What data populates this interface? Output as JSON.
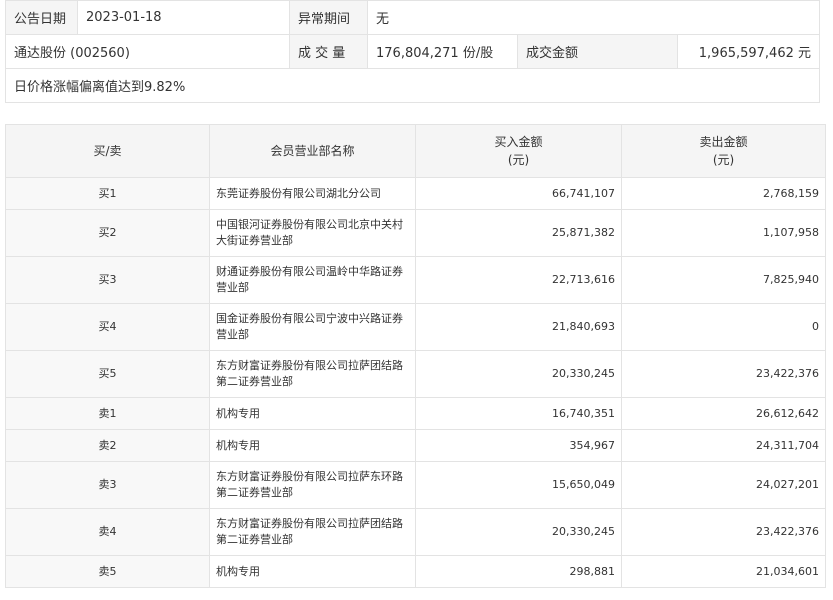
{
  "summary": {
    "announce_date_label": "公告日期",
    "announce_date_value": "2023-01-18",
    "abnormal_period_label": "异常期间",
    "abnormal_period_value": "无",
    "stock_name": "通达股份 (002560)",
    "volume_label": "成 交 量",
    "volume_value": "176,804,271 份/股",
    "amount_label": "成交金额",
    "amount_value": "1,965,597,462 元",
    "reason": "日价格涨幅偏离值达到9.82%"
  },
  "detail": {
    "headers": {
      "side": "买/卖",
      "dept": "会员营业部名称",
      "buy": "买入金额",
      "buy_unit": "(元)",
      "sell": "卖出金额",
      "sell_unit": "(元)"
    },
    "rows": [
      {
        "side": "买1",
        "dept": "东莞证券股份有限公司湖北分公司",
        "buy": "66,741,107",
        "sell": "2,768,159"
      },
      {
        "side": "买2",
        "dept": "中国银河证券股份有限公司北京中关村大街证券营业部",
        "buy": "25,871,382",
        "sell": "1,107,958"
      },
      {
        "side": "买3",
        "dept": "财通证券股份有限公司温岭中华路证券营业部",
        "buy": "22,713,616",
        "sell": "7,825,940"
      },
      {
        "side": "买4",
        "dept": "国金证券股份有限公司宁波中兴路证券营业部",
        "buy": "21,840,693",
        "sell": "0"
      },
      {
        "side": "买5",
        "dept": "东方财富证券股份有限公司拉萨团结路第二证券营业部",
        "buy": "20,330,245",
        "sell": "23,422,376"
      },
      {
        "side": "卖1",
        "dept": "机构专用",
        "buy": "16,740,351",
        "sell": "26,612,642"
      },
      {
        "side": "卖2",
        "dept": "机构专用",
        "buy": "354,967",
        "sell": "24,311,704"
      },
      {
        "side": "卖3",
        "dept": "东方财富证券股份有限公司拉萨东环路第二证券营业部",
        "buy": "15,650,049",
        "sell": "24,027,201"
      },
      {
        "side": "卖4",
        "dept": "东方财富证券股份有限公司拉萨团结路第二证券营业部",
        "buy": "20,330,245",
        "sell": "23,422,376"
      },
      {
        "side": "卖5",
        "dept": "机构专用",
        "buy": "298,881",
        "sell": "21,034,601"
      }
    ]
  }
}
